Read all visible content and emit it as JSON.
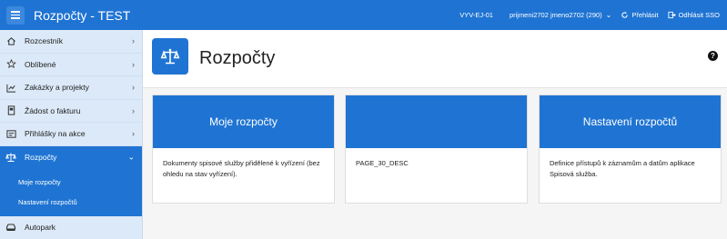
{
  "header": {
    "app_title": "Rozpočty - TEST",
    "env": "VYV-EJ-01",
    "user": "prijmeni2702 jmeno2702 (290)",
    "relogin_label": "Přehlásit",
    "logout_label": "Odhlásit SSO"
  },
  "sidebar": {
    "items": [
      {
        "label": "Rozcestník",
        "icon": "home-icon"
      },
      {
        "label": "Oblíbené",
        "icon": "star-icon"
      },
      {
        "label": "Zakázky a projekty",
        "icon": "projects-icon"
      },
      {
        "label": "Žádost o fakturu",
        "icon": "invoice-icon"
      },
      {
        "label": "Přihlášky na akce",
        "icon": "event-icon"
      },
      {
        "label": "Rozpočty",
        "icon": "scale-icon"
      },
      {
        "label": "Autopark",
        "icon": "car-icon"
      }
    ],
    "subitems": [
      {
        "label": "Moje rozpočty"
      },
      {
        "label": "Nastavení rozpočtů"
      }
    ]
  },
  "page": {
    "title": "Rozpočty",
    "help": "?"
  },
  "cards": [
    {
      "title": "Moje rozpočty",
      "desc": "Dokumenty spisové služby přidělené k vyřízení (bez ohledu na stav vyřízení)."
    },
    {
      "title": "",
      "desc": "PAGE_30_DESC"
    },
    {
      "title": "Nastavení rozpočtů",
      "desc": "Definice přístupů k záznamům a datům aplikace Spisová služba."
    }
  ],
  "colors": {
    "primary": "#1f74d3",
    "sidebar_bg": "#dce9f8",
    "page_bg": "#f5f5f5"
  }
}
